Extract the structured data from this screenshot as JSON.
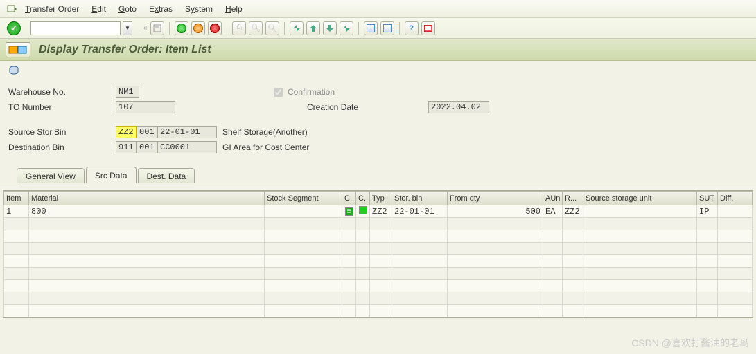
{
  "menu": {
    "items": [
      "Transfer Order",
      "Edit",
      "Goto",
      "Extras",
      "System",
      "Help"
    ]
  },
  "title": "Display Transfer Order: Item List",
  "form": {
    "warehouse_label": "Warehouse No.",
    "warehouse_value": "NM1",
    "to_number_label": "TO Number",
    "to_number_value": "107",
    "confirmation_label": "Confirmation",
    "creation_date_label": "Creation Date",
    "creation_date_value": "2022.04.02",
    "src_bin_label": "Source Stor.Bin",
    "src_type": "ZZ2",
    "src_sec": "001",
    "src_bin": "22-01-01",
    "src_desc": "Shelf Storage(Another)",
    "dst_bin_label": "Destination Bin",
    "dst_type": "911",
    "dst_sec": "001",
    "dst_bin": "CC0001",
    "dst_desc": "GI Area for Cost Center"
  },
  "tabs": [
    "General View",
    "Src Data",
    "Dest. Data"
  ],
  "active_tab": 1,
  "grid": {
    "columns": [
      "Item",
      "Material",
      "Stock Segment",
      "C..",
      "C..",
      "Typ",
      "Stor. bin",
      "From qty",
      "AUn",
      "R...",
      "Source storage unit",
      "SUT",
      "Diff."
    ],
    "row": {
      "item": "1",
      "material": "800",
      "stock_segment": "",
      "typ": "ZZ2",
      "stor_bin": "22-01-01",
      "from_qty": "500",
      "aun": "EA",
      "r": "ZZ2",
      "source_su": "",
      "sut": "IP",
      "diff": ""
    }
  },
  "watermark": "CSDN @喜欢打酱油的老鸟"
}
